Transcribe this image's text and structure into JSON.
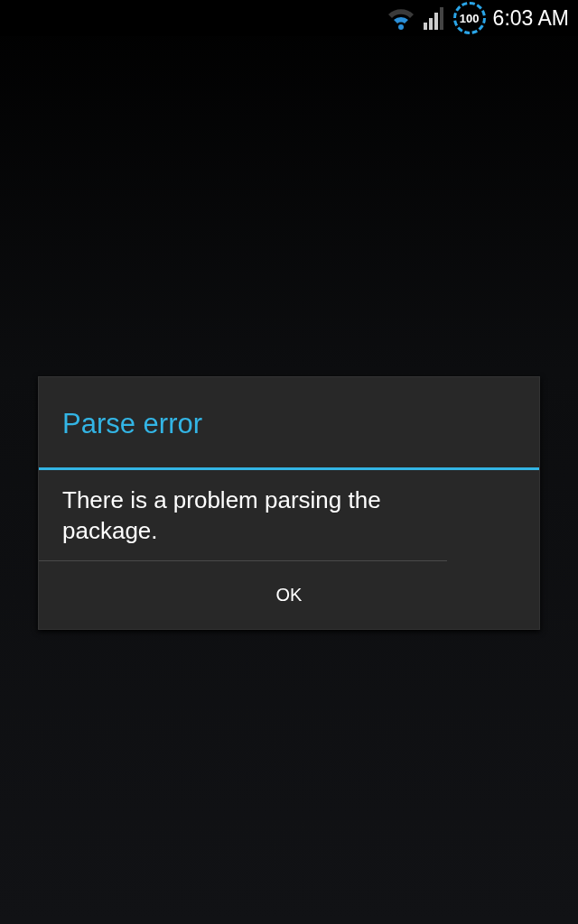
{
  "status_bar": {
    "battery": "100",
    "time": "6:03 AM"
  },
  "dialog": {
    "title": "Parse error",
    "message": "There is a problem parsing the package.",
    "buttons": [
      "OK"
    ]
  }
}
